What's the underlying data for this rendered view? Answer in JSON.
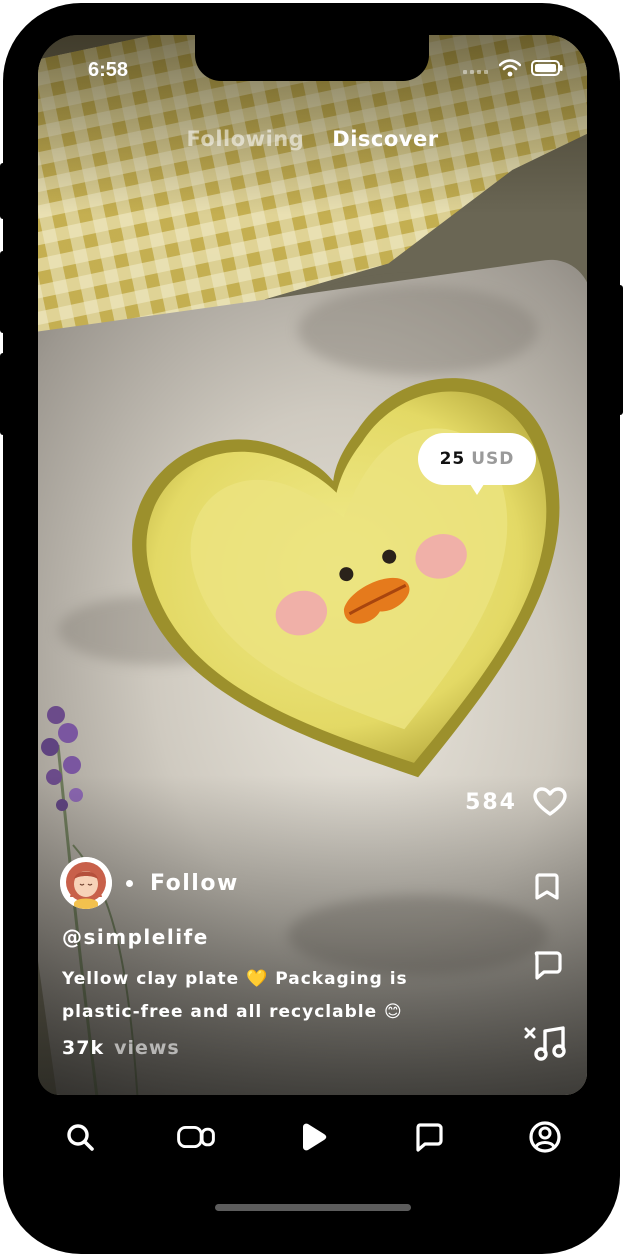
{
  "status_bar": {
    "time": "6:58"
  },
  "feed_tabs": [
    {
      "label": "Following",
      "active": false
    },
    {
      "label": "Discover",
      "active": true
    }
  ],
  "product": {
    "price_amount": "25",
    "price_currency": "USD"
  },
  "actions": {
    "like_count": "584"
  },
  "creator": {
    "follow_label": "Follow",
    "handle": "@simplelife"
  },
  "post": {
    "caption_line1": "Yellow clay plate 💛 Packaging is",
    "caption_line2": "plastic-free and all recyclable 😊",
    "views_count": "37k",
    "views_label": "views"
  },
  "icons": {
    "like": "heart-icon",
    "save": "bookmark-icon",
    "comment": "comment-icon",
    "sound": "music-note-muted-icon",
    "nav": [
      "search-icon",
      "video-camera-icon",
      "play-icon",
      "chat-icon",
      "profile-icon"
    ]
  },
  "colors": {
    "accent": "#ffffff",
    "plate": "#ece57a",
    "frame": "#000000"
  }
}
